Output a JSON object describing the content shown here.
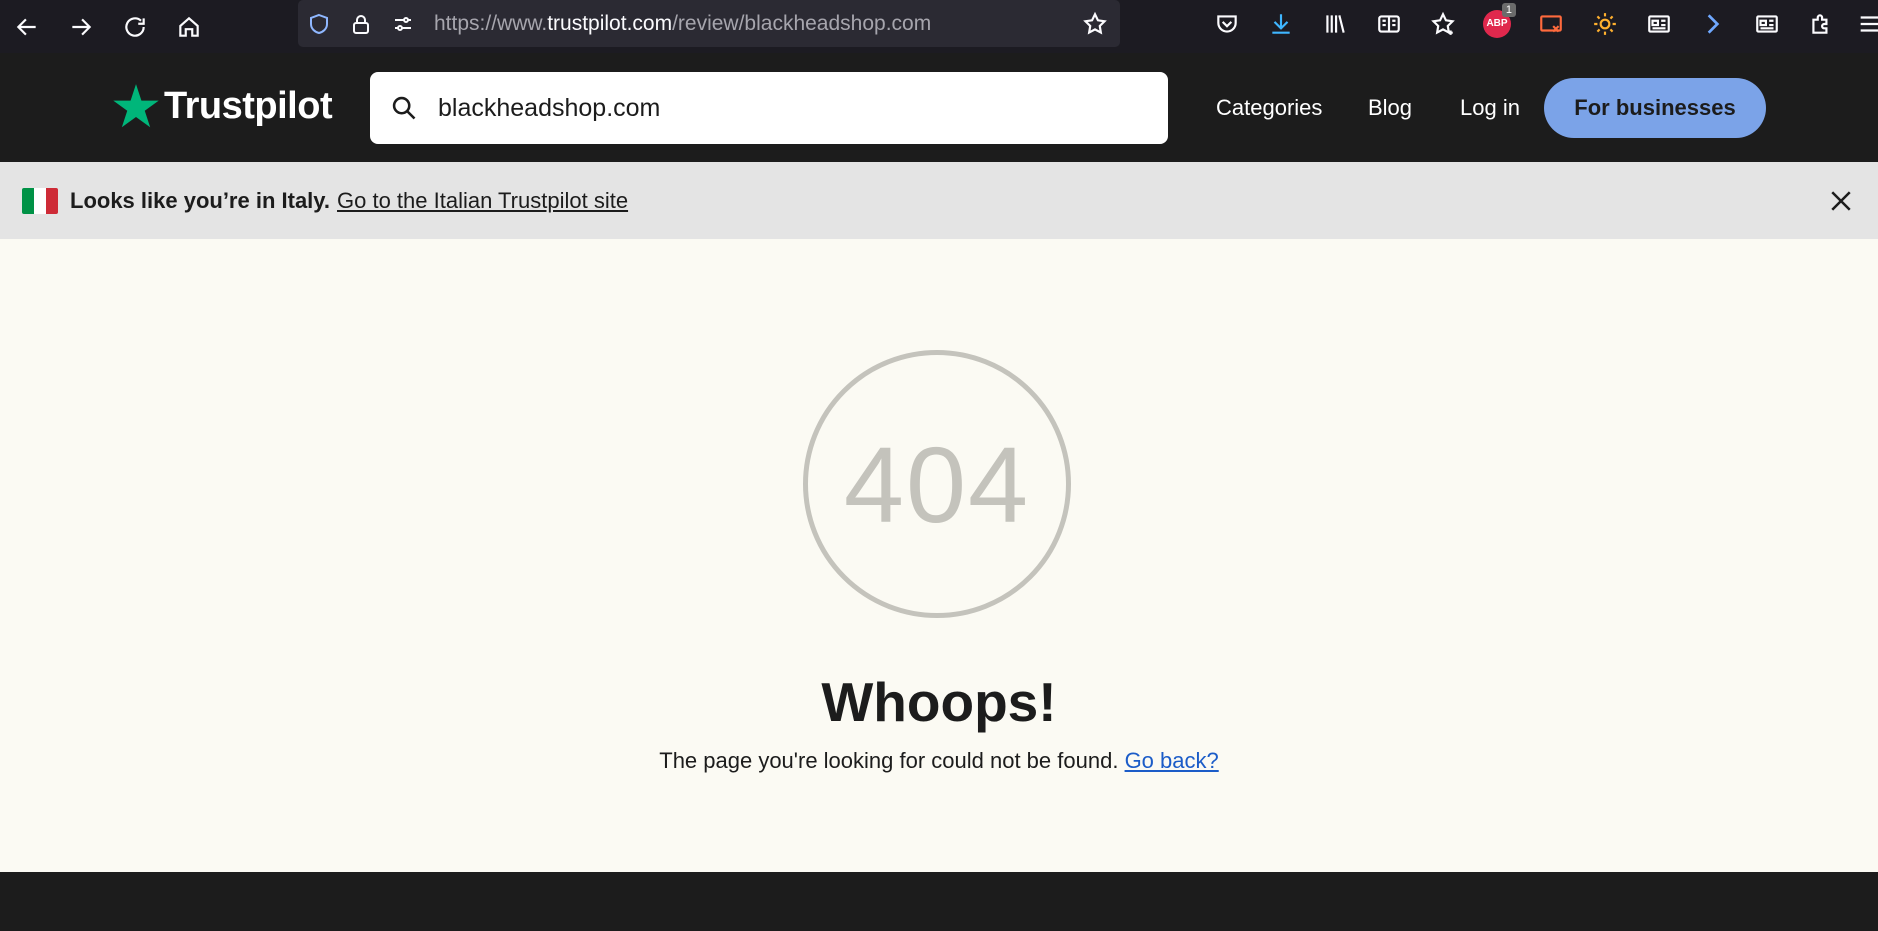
{
  "browser": {
    "url_prefix": "https://www.",
    "url_host": "trustpilot.com",
    "url_path": "/review/blackheadshop.com",
    "abp_label": "ABP",
    "abp_count": "1"
  },
  "header": {
    "logo_text": "Trustpilot",
    "search_value": "blackheadshop.com",
    "nav": {
      "categories": "Categories",
      "blog": "Blog",
      "login": "Log in",
      "for_businesses": "For businesses"
    },
    "colors": {
      "logo_star": "#00b67a",
      "business_button": "#7ba3e8"
    }
  },
  "banner": {
    "bold_text": "Looks like you’re in Italy.",
    "link_text": "Go to the Italian Trustpilot site",
    "flag_colors": [
      "#009246",
      "#ffffff",
      "#ce2b37"
    ]
  },
  "main": {
    "error_code": "404",
    "headline": "Whoops!",
    "message": "The page you're looking for could not be found.",
    "back_link": "Go back?"
  }
}
